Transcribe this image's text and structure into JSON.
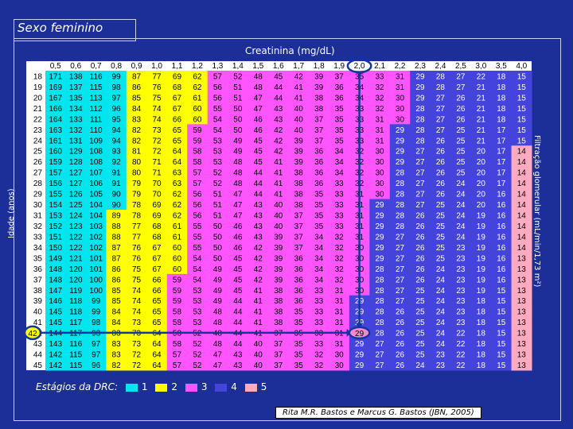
{
  "slide": {
    "title": "Sexo feminino",
    "subtitle": "Creatinina (mg/dL)",
    "ylabel": "Idade (anos)",
    "right_label": "Filtração glomerular (mL/min/1,73 m²)",
    "legend_title": "Estágios da DRC:",
    "legend": [
      {
        "label": "1",
        "color": "#00e5ee"
      },
      {
        "label": "2",
        "color": "#ffff00"
      },
      {
        "label": "3",
        "color": "#ff55ff"
      },
      {
        "label": "4",
        "color": "#4444dd"
      },
      {
        "label": "5",
        "color": "#ffaac0"
      }
    ],
    "credit": "Rita M.R. Bastos e Marcus G. Bastos (JBN, 2005)",
    "highlight": {
      "creatinine": "2,0",
      "age": "42",
      "gfr": "29",
      "color": "#1535a0"
    }
  },
  "chart_data": {
    "type": "table",
    "title": "Sexo feminino",
    "xlabel": "Creatinina (mg/dL)",
    "ylabel": "Idade (anos)",
    "columns": [
      "0,5",
      "0,6",
      "0,7",
      "0,8",
      "0,9",
      "1,0",
      "1,1",
      "1,2",
      "1,3",
      "1,4",
      "1,5",
      "1,6",
      "1,7",
      "1,8",
      "1,9",
      "2,0",
      "2,1",
      "2,2",
      "2,3",
      "2,4",
      "2,5",
      "3,0",
      "3,5",
      "4,0"
    ],
    "ages": [
      18,
      19,
      20,
      21,
      22,
      23,
      24,
      25,
      26,
      27,
      28,
      29,
      30,
      31,
      32,
      33,
      34,
      35,
      36,
      37,
      38,
      39,
      40,
      41,
      42,
      43,
      44,
      45
    ],
    "stage_colors": {
      "1": "#00e5ee",
      "2": "#ffff00",
      "3": "#ff55ff",
      "4": "#4444dd",
      "5": "#ffaac0"
    },
    "rows": [
      [
        "171",
        "138",
        "116",
        "99",
        "87",
        "77",
        "69",
        "62",
        "57",
        "52",
        "48",
        "45",
        "42",
        "39",
        "37",
        "35",
        "33",
        "31",
        "29",
        "28",
        "27",
        "22",
        "18",
        "15"
      ],
      [
        "169",
        "137",
        "115",
        "98",
        "86",
        "76",
        "68",
        "62",
        "56",
        "51",
        "48",
        "44",
        "41",
        "39",
        "36",
        "34",
        "32",
        "31",
        "29",
        "28",
        "27",
        "21",
        "18",
        "15"
      ],
      [
        "167",
        "135",
        "113",
        "97",
        "85",
        "75",
        "67",
        "61",
        "56",
        "51",
        "47",
        "44",
        "41",
        "38",
        "36",
        "34",
        "32",
        "30",
        "29",
        "27",
        "26",
        "21",
        "18",
        "15"
      ],
      [
        "166",
        "134",
        "112",
        "96",
        "84",
        "74",
        "67",
        "60",
        "55",
        "50",
        "47",
        "43",
        "40",
        "38",
        "35",
        "33",
        "32",
        "30",
        "28",
        "27",
        "26",
        "21",
        "18",
        "15"
      ],
      [
        "164",
        "133",
        "111",
        "95",
        "83",
        "74",
        "66",
        "60",
        "54",
        "50",
        "46",
        "43",
        "40",
        "37",
        "35",
        "33",
        "31",
        "30",
        "28",
        "27",
        "26",
        "21",
        "18",
        "15"
      ],
      [
        "163",
        "132",
        "110",
        "94",
        "82",
        "73",
        "65",
        "59",
        "54",
        "50",
        "46",
        "42",
        "40",
        "37",
        "35",
        "33",
        "31",
        "29",
        "28",
        "27",
        "25",
        "21",
        "17",
        "15"
      ],
      [
        "161",
        "131",
        "109",
        "94",
        "82",
        "72",
        "65",
        "59",
        "53",
        "49",
        "45",
        "42",
        "39",
        "37",
        "35",
        "33",
        "31",
        "29",
        "28",
        "26",
        "25",
        "21",
        "17",
        "15"
      ],
      [
        "160",
        "129",
        "108",
        "93",
        "81",
        "72",
        "64",
        "58",
        "53",
        "49",
        "45",
        "42",
        "39",
        "36",
        "34",
        "32",
        "30",
        "29",
        "27",
        "26",
        "25",
        "20",
        "17",
        "14"
      ],
      [
        "159",
        "128",
        "108",
        "92",
        "80",
        "71",
        "64",
        "58",
        "53",
        "48",
        "45",
        "41",
        "39",
        "36",
        "34",
        "32",
        "30",
        "29",
        "27",
        "26",
        "25",
        "20",
        "17",
        "14"
      ],
      [
        "157",
        "127",
        "107",
        "91",
        "80",
        "71",
        "63",
        "57",
        "52",
        "48",
        "44",
        "41",
        "38",
        "36",
        "34",
        "32",
        "30",
        "28",
        "27",
        "26",
        "25",
        "20",
        "17",
        "14"
      ],
      [
        "156",
        "127",
        "106",
        "91",
        "79",
        "70",
        "63",
        "57",
        "52",
        "48",
        "44",
        "41",
        "38",
        "36",
        "33",
        "32",
        "30",
        "28",
        "27",
        "26",
        "24",
        "20",
        "17",
        "14"
      ],
      [
        "155",
        "126",
        "105",
        "90",
        "79",
        "70",
        "62",
        "56",
        "51",
        "47",
        "44",
        "41",
        "38",
        "35",
        "33",
        "31",
        "30",
        "28",
        "27",
        "26",
        "24",
        "20",
        "16",
        "14"
      ],
      [
        "154",
        "125",
        "104",
        "90",
        "78",
        "69",
        "62",
        "56",
        "51",
        "47",
        "43",
        "40",
        "38",
        "35",
        "33",
        "31",
        "29",
        "28",
        "27",
        "25",
        "24",
        "20",
        "16",
        "14"
      ],
      [
        "153",
        "124",
        "104",
        "89",
        "78",
        "69",
        "62",
        "56",
        "51",
        "47",
        "43",
        "40",
        "37",
        "35",
        "33",
        "31",
        "29",
        "28",
        "26",
        "25",
        "24",
        "19",
        "16",
        "14"
      ],
      [
        "152",
        "123",
        "103",
        "88",
        "77",
        "68",
        "61",
        "55",
        "50",
        "46",
        "43",
        "40",
        "37",
        "35",
        "33",
        "31",
        "29",
        "28",
        "26",
        "25",
        "24",
        "19",
        "16",
        "14"
      ],
      [
        "151",
        "122",
        "102",
        "88",
        "77",
        "68",
        "61",
        "55",
        "50",
        "46",
        "43",
        "39",
        "37",
        "34",
        "32",
        "31",
        "29",
        "27",
        "26",
        "25",
        "24",
        "19",
        "16",
        "14"
      ],
      [
        "150",
        "122",
        "102",
        "87",
        "76",
        "67",
        "60",
        "55",
        "50",
        "46",
        "42",
        "39",
        "37",
        "34",
        "32",
        "30",
        "29",
        "27",
        "26",
        "25",
        "23",
        "19",
        "16",
        "14"
      ],
      [
        "149",
        "121",
        "101",
        "87",
        "76",
        "67",
        "60",
        "54",
        "50",
        "45",
        "42",
        "39",
        "36",
        "34",
        "32",
        "30",
        "29",
        "27",
        "26",
        "25",
        "23",
        "19",
        "16",
        "13"
      ],
      [
        "148",
        "120",
        "101",
        "86",
        "75",
        "67",
        "60",
        "54",
        "49",
        "45",
        "42",
        "39",
        "36",
        "34",
        "32",
        "30",
        "28",
        "27",
        "26",
        "24",
        "23",
        "19",
        "16",
        "13"
      ],
      [
        "148",
        "120",
        "100",
        "86",
        "75",
        "66",
        "59",
        "54",
        "49",
        "45",
        "42",
        "39",
        "36",
        "34",
        "32",
        "30",
        "28",
        "27",
        "26",
        "24",
        "23",
        "19",
        "16",
        "13"
      ],
      [
        "147",
        "119",
        "100",
        "85",
        "74",
        "66",
        "59",
        "53",
        "49",
        "45",
        "41",
        "38",
        "36",
        "33",
        "31",
        "30",
        "28",
        "27",
        "25",
        "24",
        "23",
        "19",
        "15",
        "13"
      ],
      [
        "146",
        "118",
        "99",
        "85",
        "74",
        "65",
        "59",
        "53",
        "49",
        "44",
        "41",
        "38",
        "36",
        "33",
        "31",
        "29",
        "28",
        "27",
        "25",
        "24",
        "23",
        "18",
        "15",
        "13"
      ],
      [
        "145",
        "118",
        "99",
        "84",
        "74",
        "65",
        "58",
        "53",
        "48",
        "44",
        "41",
        "38",
        "35",
        "33",
        "31",
        "29",
        "28",
        "26",
        "25",
        "24",
        "23",
        "18",
        "15",
        "13"
      ],
      [
        "145",
        "117",
        "98",
        "84",
        "73",
        "65",
        "58",
        "53",
        "48",
        "44",
        "41",
        "38",
        "35",
        "33",
        "31",
        "29",
        "28",
        "26",
        "25",
        "24",
        "23",
        "18",
        "15",
        "13"
      ],
      [
        "144",
        "117",
        "98",
        "83",
        "73",
        "64",
        "58",
        "52",
        "48",
        "44",
        "41",
        "37",
        "35",
        "33",
        "31",
        "29",
        "28",
        "26",
        "25",
        "24",
        "22",
        "18",
        "15",
        "13"
      ],
      [
        "143",
        "116",
        "97",
        "83",
        "73",
        "64",
        "58",
        "52",
        "48",
        "44",
        "40",
        "37",
        "35",
        "33",
        "31",
        "29",
        "27",
        "26",
        "25",
        "24",
        "22",
        "18",
        "15",
        "13"
      ],
      [
        "142",
        "115",
        "97",
        "83",
        "72",
        "64",
        "57",
        "52",
        "47",
        "43",
        "40",
        "37",
        "35",
        "32",
        "30",
        "29",
        "27",
        "26",
        "25",
        "23",
        "22",
        "18",
        "15",
        "13"
      ],
      [
        "142",
        "115",
        "96",
        "82",
        "72",
        "64",
        "57",
        "52",
        "47",
        "43",
        "40",
        "37",
        "35",
        "32",
        "30",
        "29",
        "27",
        "26",
        "24",
        "23",
        "22",
        "18",
        "15",
        "13"
      ]
    ]
  }
}
